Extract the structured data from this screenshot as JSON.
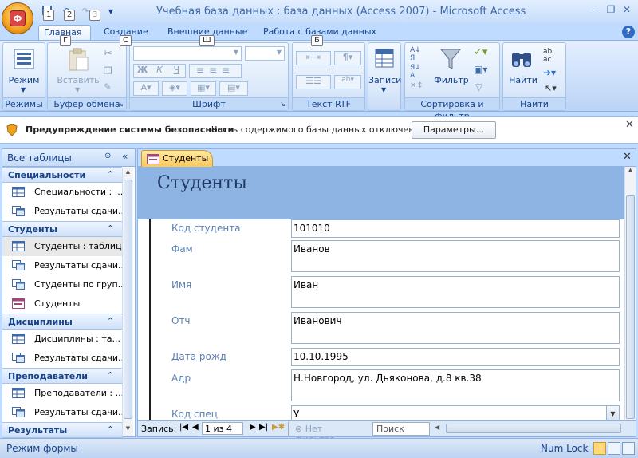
{
  "window": {
    "title": "Учебная база данных : база данных (Access 2007) - Microsoft Access",
    "office_button_letter": "Ф",
    "qat_keytips": [
      "1",
      "2",
      "3"
    ]
  },
  "ribbon_tabs": [
    {
      "label": "Главная",
      "keytip": "Г",
      "active": true
    },
    {
      "label": "Создание",
      "keytip": "С"
    },
    {
      "label": "Внешние данные",
      "keytip": "Ш"
    },
    {
      "label": "Работа с базами данных",
      "keytip": "Б"
    }
  ],
  "ribbon_groups": {
    "views": {
      "label": "Режимы",
      "button": "Режим"
    },
    "clipboard": {
      "label": "Буфер обмена",
      "button": "Вставить"
    },
    "font": {
      "label": "Шрифт",
      "bold": "Ж",
      "italic": "К",
      "underline": "Ч"
    },
    "rich_text": {
      "label": "Текст RTF"
    },
    "records": {
      "button": "Записи"
    },
    "sort_filter": {
      "label": "Сортировка и фильтр",
      "button": "Фильтр"
    },
    "find": {
      "label": "Найти",
      "button": "Найти"
    }
  },
  "security_bar": {
    "title": "Предупреждение системы безопасности",
    "message": "Часть содержимого базы данных отключено",
    "button": "Параметры..."
  },
  "nav_pane": {
    "header": "Все таблицы",
    "groups": [
      {
        "label": "Специальности",
        "items": [
          {
            "label": "Специальности : ...",
            "icon": "table-icon"
          },
          {
            "label": "Результаты сдачи...",
            "icon": "query-icon"
          }
        ]
      },
      {
        "label": "Студенты",
        "items": [
          {
            "label": "Студенты : таблица",
            "icon": "table-icon",
            "selected": true
          },
          {
            "label": "Результаты сдачи...",
            "icon": "query-icon"
          },
          {
            "label": "Студенты по груп...",
            "icon": "query-icon"
          },
          {
            "label": "Студенты",
            "icon": "form-icon"
          }
        ]
      },
      {
        "label": "Дисциплины",
        "items": [
          {
            "label": "Дисциплины : та...",
            "icon": "table-icon"
          },
          {
            "label": "Результаты сдачи...",
            "icon": "query-icon"
          }
        ]
      },
      {
        "label": "Преподаватели",
        "items": [
          {
            "label": "Преподаватели : ...",
            "icon": "table-icon"
          },
          {
            "label": "Результаты сдачи...",
            "icon": "query-icon"
          }
        ]
      },
      {
        "label": "Результаты",
        "items": []
      }
    ]
  },
  "document": {
    "tab_label": "Студенты",
    "form_title": "Студенты",
    "fields": [
      {
        "label": "Код студента",
        "value": "101010"
      },
      {
        "label": "Фам",
        "value": "Иванов"
      },
      {
        "label": "Имя",
        "value": "Иван"
      },
      {
        "label": "Отч",
        "value": "Иванович"
      },
      {
        "label": "Дата рожд",
        "value": "10.10.1995"
      },
      {
        "label": "Адр",
        "value": "Н.Новгород, ул. Дьяконова, д.8 кв.38"
      },
      {
        "label": "Код спец",
        "value": "У"
      }
    ],
    "record_nav": {
      "label": "Запись:",
      "position": "1 из 4",
      "filter": "Нет фильтра",
      "search": "Поиск"
    }
  },
  "statusbar": {
    "mode": "Режим формы",
    "numlock": "Num Lock"
  },
  "colors": {
    "accent": "#15428b",
    "ribbon": "#c7dcf8",
    "form_header": "#8db4e2",
    "field_label": "#5b7fb3",
    "active_doc_tab": "#fbc85a"
  }
}
